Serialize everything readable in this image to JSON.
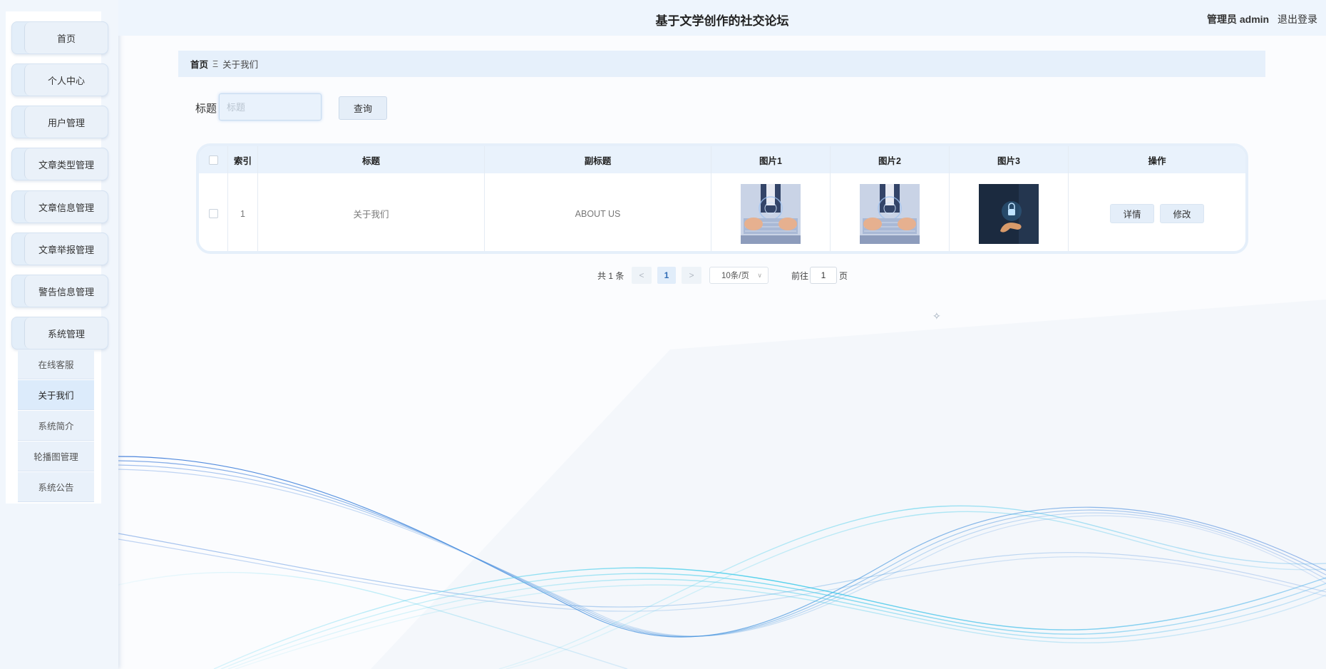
{
  "header": {
    "title": "基于文学创作的社交论坛",
    "role_label": "管理员 admin",
    "logout_label": "退出登录"
  },
  "sidebar": {
    "items": [
      {
        "label": "首页"
      },
      {
        "label": "个人中心"
      },
      {
        "label": "用户管理"
      },
      {
        "label": "文章类型管理"
      },
      {
        "label": "文章信息管理"
      },
      {
        "label": "文章举报管理"
      },
      {
        "label": "警告信息管理"
      },
      {
        "label": "系统管理"
      }
    ],
    "submenu": [
      {
        "label": "在线客服",
        "active": false
      },
      {
        "label": "关于我们",
        "active": true
      },
      {
        "label": "系统简介",
        "active": false
      },
      {
        "label": "轮播图管理",
        "active": false
      },
      {
        "label": "系统公告",
        "active": false
      }
    ]
  },
  "breadcrumb": {
    "home": "首页",
    "separator": "Ξ",
    "current": "关于我们"
  },
  "search": {
    "label": "标题",
    "placeholder": "标题",
    "value": "",
    "button_label": "查询"
  },
  "table": {
    "columns": [
      "索引",
      "标题",
      "副标题",
      "图片1",
      "图片2",
      "图片3",
      "操作"
    ],
    "rows": [
      {
        "index": "1",
        "title": "关于我们",
        "subtitle": "ABOUT US",
        "image1": "hands-typing-keyboard-image",
        "image2": "hands-typing-keyboard-image",
        "image3": "hand-holding-lock-image"
      }
    ],
    "action_labels": {
      "detail": "详情",
      "edit": "修改"
    }
  },
  "pagination": {
    "total_text": "共 1 条",
    "prev": "<",
    "current_page": "1",
    "next": ">",
    "page_size": "10条/页",
    "goto_label": "前往",
    "goto_value": "1",
    "page_unit": "页"
  },
  "colors": {
    "accent": "#2f6bb5",
    "wave_blue": "#3a78d8",
    "wave_cyan": "#2ec8e8"
  }
}
